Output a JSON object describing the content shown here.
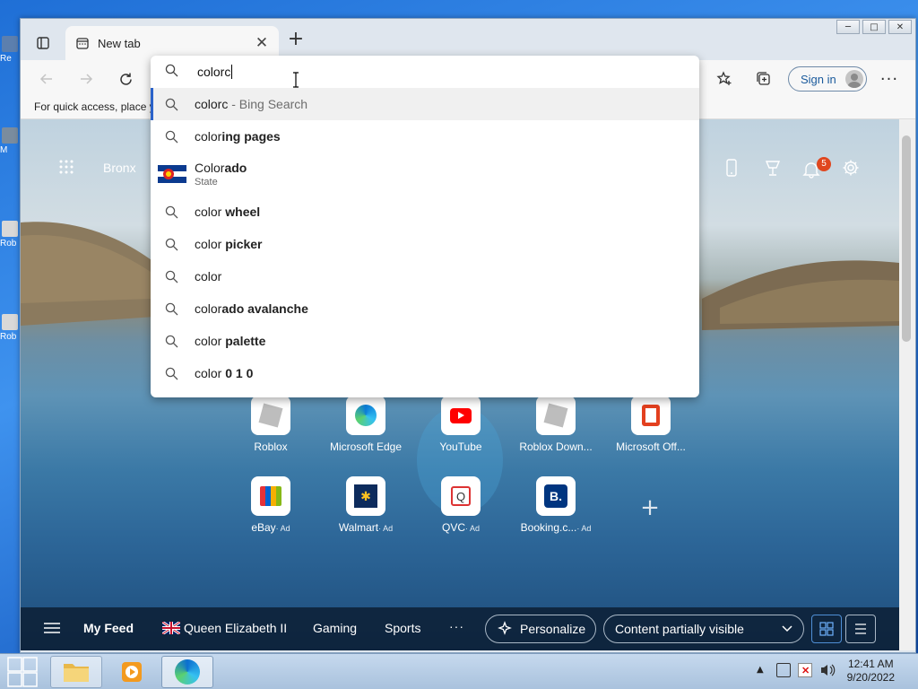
{
  "desktop": {
    "icons": [
      "Re",
      "M",
      "Rob",
      "Rob"
    ]
  },
  "window": {
    "caption_buttons": [
      "─",
      "□",
      "✕"
    ]
  },
  "browser": {
    "tab": {
      "title": "New tab"
    },
    "favorites_bar_text": "For quick access, place y",
    "sign_in": "Sign in"
  },
  "omnibox": {
    "query": "colorc",
    "suggestions": [
      {
        "type": "search",
        "prefix": "colorc",
        "suffix": " - Bing Search",
        "suffix_style": "gray",
        "selected": true
      },
      {
        "type": "search",
        "prefix": "color",
        "suffix": "ing pages",
        "suffix_style": "bold"
      },
      {
        "type": "entity",
        "prefix": "Color",
        "suffix": "ado",
        "suffix_style": "bold",
        "subtitle": "State"
      },
      {
        "type": "search",
        "prefix": "color",
        "suffix": " wheel",
        "suffix_style": "bold"
      },
      {
        "type": "search",
        "prefix": "color",
        "suffix": " picker",
        "suffix_style": "bold"
      },
      {
        "type": "search",
        "prefix": "color",
        "suffix": "",
        "suffix_style": "bold"
      },
      {
        "type": "search",
        "prefix": "color",
        "suffix": "ado avalanche",
        "suffix_style": "bold"
      },
      {
        "type": "search",
        "prefix": "color",
        "suffix": " palette",
        "suffix_style": "bold"
      },
      {
        "type": "search",
        "prefix": "color",
        "suffix": " 0 1 0",
        "suffix_style": "bold"
      }
    ]
  },
  "newtab": {
    "location": "Bronx",
    "notification_count": "5",
    "quick_links_row1": [
      {
        "label": "Roblox",
        "ad": "",
        "icon": "roblox-icon"
      },
      {
        "label": "Microsoft Edge",
        "ad": "",
        "icon": "edge-icon"
      },
      {
        "label": "YouTube",
        "ad": "",
        "icon": "youtube-icon"
      },
      {
        "label": "Roblox Down...",
        "ad": "",
        "icon": "roblox-icon"
      },
      {
        "label": "Microsoft Off...",
        "ad": "",
        "icon": "office-icon"
      }
    ],
    "quick_links_row2": [
      {
        "label": "eBay",
        "ad": "· Ad",
        "icon": "ebay-icon"
      },
      {
        "label": "Walmart",
        "ad": "· Ad",
        "icon": "walmart-icon"
      },
      {
        "label": "QVC",
        "ad": "· Ad",
        "icon": "qvc-icon"
      },
      {
        "label": "Booking.c...",
        "ad": "· Ad",
        "icon": "booking-icon"
      }
    ],
    "add_site": "+",
    "feed": {
      "my_feed": "My Feed",
      "topics": [
        "Queen Elizabeth II",
        "Gaming",
        "Sports"
      ],
      "more": "···",
      "personalize": "Personalize",
      "content_visibility": "Content partially visible"
    }
  },
  "taskbar": {
    "time": "12:41 AM",
    "date": "9/20/2022"
  },
  "colors": {
    "accent": "#2a62c9",
    "badge": "#e0471f"
  }
}
